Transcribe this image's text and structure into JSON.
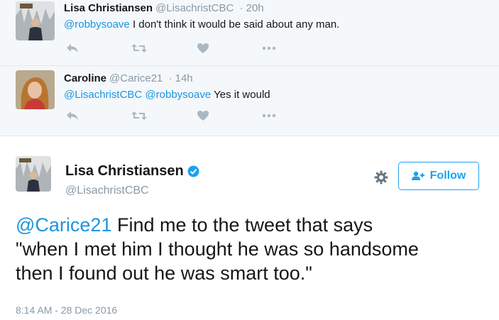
{
  "colors": {
    "link": "#1b95e0",
    "muted": "#8899a6",
    "follow": "#1da1f2",
    "verified": "#1da1f2"
  },
  "replies": [
    {
      "name": "Lisa Christiansen",
      "handle": "@LisachristCBC",
      "time": "· 20h",
      "mention": "@robbysoave",
      "text": " I don't think it would be said about any man."
    },
    {
      "name": "Caroline",
      "handle": "@Carice21",
      "time": "· 14h",
      "mention1": "@LisachristCBC",
      "mention2": "@robbysoave",
      "text": " Yes it would"
    }
  ],
  "reply_actions": {
    "icons": [
      "reply-icon",
      "retweet-icon",
      "like-icon",
      "more-icon"
    ]
  },
  "main_tweet": {
    "name": "Lisa Christiansen",
    "handle": "@LisachristCBC",
    "follow_label": "Follow",
    "mention": "@Carice21",
    "text_line1": " Find me to the tweet that says",
    "text_line2": "\"when I met him I thought he was so handsome",
    "text_line3": "then I found out he was smart too.\"",
    "timestamp": "8:14 AM - 28 Dec 2016"
  }
}
